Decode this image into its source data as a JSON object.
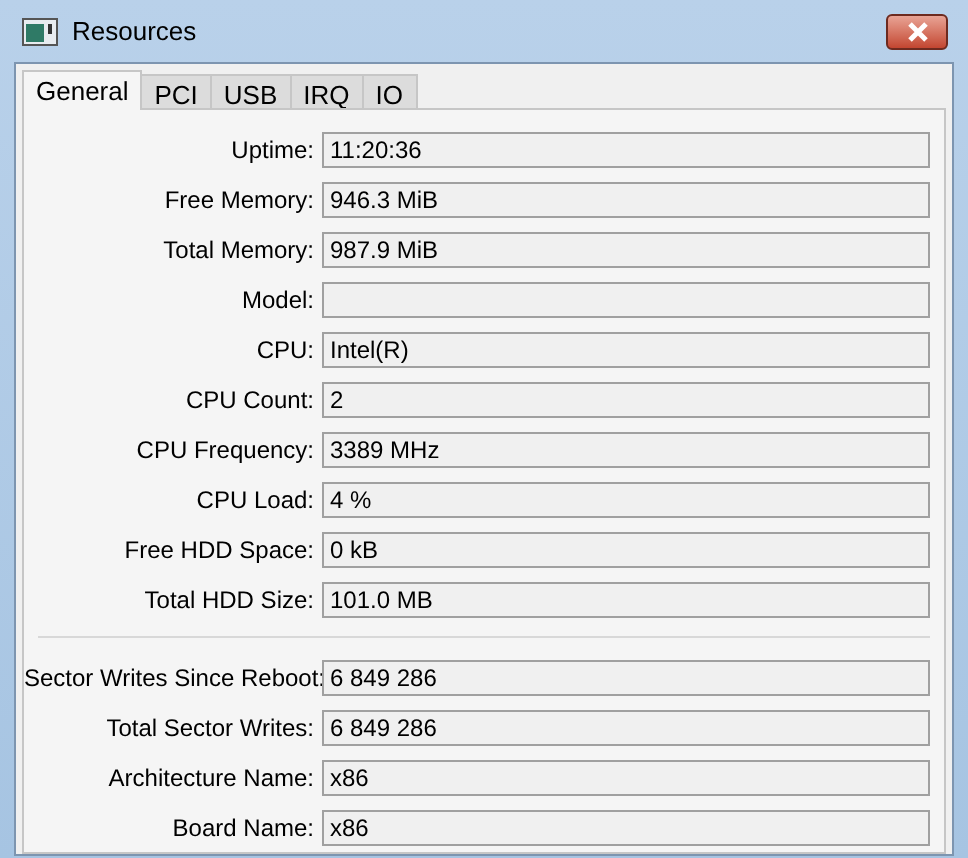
{
  "window": {
    "title": "Resources"
  },
  "tabs": [
    {
      "label": "General",
      "selected": true
    },
    {
      "label": "PCI",
      "selected": false
    },
    {
      "label": "USB",
      "selected": false
    },
    {
      "label": "IRQ",
      "selected": false
    },
    {
      "label": "IO",
      "selected": false
    }
  ],
  "groups": [
    {
      "fields": [
        {
          "label": "Uptime:",
          "value": "11:20:36"
        },
        {
          "label": "Free Memory:",
          "value": "946.3 MiB"
        },
        {
          "label": "Total Memory:",
          "value": "987.9 MiB"
        },
        {
          "label": "Model:"
        },
        {
          "label": "CPU:",
          "value": "Intel(R)"
        },
        {
          "label": "CPU Count:",
          "value": "2"
        },
        {
          "label": "CPU Frequency:",
          "value": "3389 MHz"
        },
        {
          "label": "CPU Load:",
          "value": "4 %"
        },
        {
          "label": "Free HDD Space:",
          "value": "0 kB"
        },
        {
          "label": "Total HDD Size:",
          "value": "101.0 MB"
        }
      ]
    },
    {
      "fields": [
        {
          "label": "Sector Writes Since Reboot:",
          "value": "6 849 286"
        },
        {
          "label": "Total Sector Writes:",
          "value": "6 849 286"
        },
        {
          "label": "Architecture Name:",
          "value": "x86"
        },
        {
          "label": "Board Name:",
          "value": "x86"
        }
      ]
    }
  ]
}
